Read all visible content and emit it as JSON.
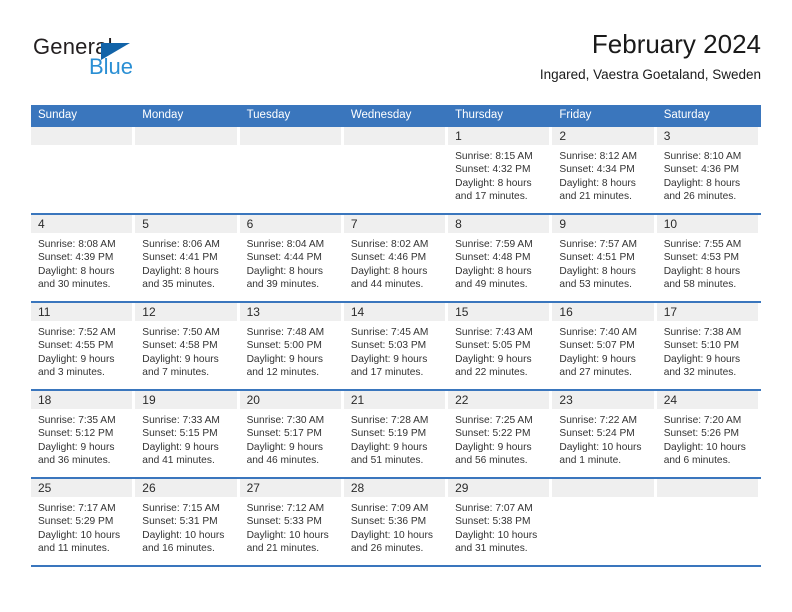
{
  "brand": {
    "name_dark": "General",
    "name_blue": "Blue",
    "color_dark": "#231f20",
    "color_blue": "#2a8fd4",
    "triangle_color": "#1263a8"
  },
  "header": {
    "title": "February 2024",
    "subtitle": "Ingared, Vaestra Goetaland, Sweden"
  },
  "theme": {
    "header_blue": "#3a76bd",
    "daynum_band": "#efefef",
    "rule_blue": "#3a76bd"
  },
  "weekdays": [
    "Sunday",
    "Monday",
    "Tuesday",
    "Wednesday",
    "Thursday",
    "Friday",
    "Saturday"
  ],
  "weeks": [
    [
      {
        "day": "",
        "empty": true,
        "sunrise": "",
        "sunset": "",
        "daylight1": "",
        "daylight2": ""
      },
      {
        "day": "",
        "empty": true,
        "sunrise": "",
        "sunset": "",
        "daylight1": "",
        "daylight2": ""
      },
      {
        "day": "",
        "empty": true,
        "sunrise": "",
        "sunset": "",
        "daylight1": "",
        "daylight2": ""
      },
      {
        "day": "",
        "empty": true,
        "sunrise": "",
        "sunset": "",
        "daylight1": "",
        "daylight2": ""
      },
      {
        "day": "1",
        "empty": false,
        "sunrise": "Sunrise: 8:15 AM",
        "sunset": "Sunset: 4:32 PM",
        "daylight1": "Daylight: 8 hours",
        "daylight2": "and 17 minutes."
      },
      {
        "day": "2",
        "empty": false,
        "sunrise": "Sunrise: 8:12 AM",
        "sunset": "Sunset: 4:34 PM",
        "daylight1": "Daylight: 8 hours",
        "daylight2": "and 21 minutes."
      },
      {
        "day": "3",
        "empty": false,
        "sunrise": "Sunrise: 8:10 AM",
        "sunset": "Sunset: 4:36 PM",
        "daylight1": "Daylight: 8 hours",
        "daylight2": "and 26 minutes."
      }
    ],
    [
      {
        "day": "4",
        "empty": false,
        "sunrise": "Sunrise: 8:08 AM",
        "sunset": "Sunset: 4:39 PM",
        "daylight1": "Daylight: 8 hours",
        "daylight2": "and 30 minutes."
      },
      {
        "day": "5",
        "empty": false,
        "sunrise": "Sunrise: 8:06 AM",
        "sunset": "Sunset: 4:41 PM",
        "daylight1": "Daylight: 8 hours",
        "daylight2": "and 35 minutes."
      },
      {
        "day": "6",
        "empty": false,
        "sunrise": "Sunrise: 8:04 AM",
        "sunset": "Sunset: 4:44 PM",
        "daylight1": "Daylight: 8 hours",
        "daylight2": "and 39 minutes."
      },
      {
        "day": "7",
        "empty": false,
        "sunrise": "Sunrise: 8:02 AM",
        "sunset": "Sunset: 4:46 PM",
        "daylight1": "Daylight: 8 hours",
        "daylight2": "and 44 minutes."
      },
      {
        "day": "8",
        "empty": false,
        "sunrise": "Sunrise: 7:59 AM",
        "sunset": "Sunset: 4:48 PM",
        "daylight1": "Daylight: 8 hours",
        "daylight2": "and 49 minutes."
      },
      {
        "day": "9",
        "empty": false,
        "sunrise": "Sunrise: 7:57 AM",
        "sunset": "Sunset: 4:51 PM",
        "daylight1": "Daylight: 8 hours",
        "daylight2": "and 53 minutes."
      },
      {
        "day": "10",
        "empty": false,
        "sunrise": "Sunrise: 7:55 AM",
        "sunset": "Sunset: 4:53 PM",
        "daylight1": "Daylight: 8 hours",
        "daylight2": "and 58 minutes."
      }
    ],
    [
      {
        "day": "11",
        "empty": false,
        "sunrise": "Sunrise: 7:52 AM",
        "sunset": "Sunset: 4:55 PM",
        "daylight1": "Daylight: 9 hours",
        "daylight2": "and 3 minutes."
      },
      {
        "day": "12",
        "empty": false,
        "sunrise": "Sunrise: 7:50 AM",
        "sunset": "Sunset: 4:58 PM",
        "daylight1": "Daylight: 9 hours",
        "daylight2": "and 7 minutes."
      },
      {
        "day": "13",
        "empty": false,
        "sunrise": "Sunrise: 7:48 AM",
        "sunset": "Sunset: 5:00 PM",
        "daylight1": "Daylight: 9 hours",
        "daylight2": "and 12 minutes."
      },
      {
        "day": "14",
        "empty": false,
        "sunrise": "Sunrise: 7:45 AM",
        "sunset": "Sunset: 5:03 PM",
        "daylight1": "Daylight: 9 hours",
        "daylight2": "and 17 minutes."
      },
      {
        "day": "15",
        "empty": false,
        "sunrise": "Sunrise: 7:43 AM",
        "sunset": "Sunset: 5:05 PM",
        "daylight1": "Daylight: 9 hours",
        "daylight2": "and 22 minutes."
      },
      {
        "day": "16",
        "empty": false,
        "sunrise": "Sunrise: 7:40 AM",
        "sunset": "Sunset: 5:07 PM",
        "daylight1": "Daylight: 9 hours",
        "daylight2": "and 27 minutes."
      },
      {
        "day": "17",
        "empty": false,
        "sunrise": "Sunrise: 7:38 AM",
        "sunset": "Sunset: 5:10 PM",
        "daylight1": "Daylight: 9 hours",
        "daylight2": "and 32 minutes."
      }
    ],
    [
      {
        "day": "18",
        "empty": false,
        "sunrise": "Sunrise: 7:35 AM",
        "sunset": "Sunset: 5:12 PM",
        "daylight1": "Daylight: 9 hours",
        "daylight2": "and 36 minutes."
      },
      {
        "day": "19",
        "empty": false,
        "sunrise": "Sunrise: 7:33 AM",
        "sunset": "Sunset: 5:15 PM",
        "daylight1": "Daylight: 9 hours",
        "daylight2": "and 41 minutes."
      },
      {
        "day": "20",
        "empty": false,
        "sunrise": "Sunrise: 7:30 AM",
        "sunset": "Sunset: 5:17 PM",
        "daylight1": "Daylight: 9 hours",
        "daylight2": "and 46 minutes."
      },
      {
        "day": "21",
        "empty": false,
        "sunrise": "Sunrise: 7:28 AM",
        "sunset": "Sunset: 5:19 PM",
        "daylight1": "Daylight: 9 hours",
        "daylight2": "and 51 minutes."
      },
      {
        "day": "22",
        "empty": false,
        "sunrise": "Sunrise: 7:25 AM",
        "sunset": "Sunset: 5:22 PM",
        "daylight1": "Daylight: 9 hours",
        "daylight2": "and 56 minutes."
      },
      {
        "day": "23",
        "empty": false,
        "sunrise": "Sunrise: 7:22 AM",
        "sunset": "Sunset: 5:24 PM",
        "daylight1": "Daylight: 10 hours",
        "daylight2": "and 1 minute."
      },
      {
        "day": "24",
        "empty": false,
        "sunrise": "Sunrise: 7:20 AM",
        "sunset": "Sunset: 5:26 PM",
        "daylight1": "Daylight: 10 hours",
        "daylight2": "and 6 minutes."
      }
    ],
    [
      {
        "day": "25",
        "empty": false,
        "sunrise": "Sunrise: 7:17 AM",
        "sunset": "Sunset: 5:29 PM",
        "daylight1": "Daylight: 10 hours",
        "daylight2": "and 11 minutes."
      },
      {
        "day": "26",
        "empty": false,
        "sunrise": "Sunrise: 7:15 AM",
        "sunset": "Sunset: 5:31 PM",
        "daylight1": "Daylight: 10 hours",
        "daylight2": "and 16 minutes."
      },
      {
        "day": "27",
        "empty": false,
        "sunrise": "Sunrise: 7:12 AM",
        "sunset": "Sunset: 5:33 PM",
        "daylight1": "Daylight: 10 hours",
        "daylight2": "and 21 minutes."
      },
      {
        "day": "28",
        "empty": false,
        "sunrise": "Sunrise: 7:09 AM",
        "sunset": "Sunset: 5:36 PM",
        "daylight1": "Daylight: 10 hours",
        "daylight2": "and 26 minutes."
      },
      {
        "day": "29",
        "empty": false,
        "sunrise": "Sunrise: 7:07 AM",
        "sunset": "Sunset: 5:38 PM",
        "daylight1": "Daylight: 10 hours",
        "daylight2": "and 31 minutes."
      },
      {
        "day": "",
        "empty": true,
        "sunrise": "",
        "sunset": "",
        "daylight1": "",
        "daylight2": ""
      },
      {
        "day": "",
        "empty": true,
        "sunrise": "",
        "sunset": "",
        "daylight1": "",
        "daylight2": ""
      }
    ]
  ]
}
